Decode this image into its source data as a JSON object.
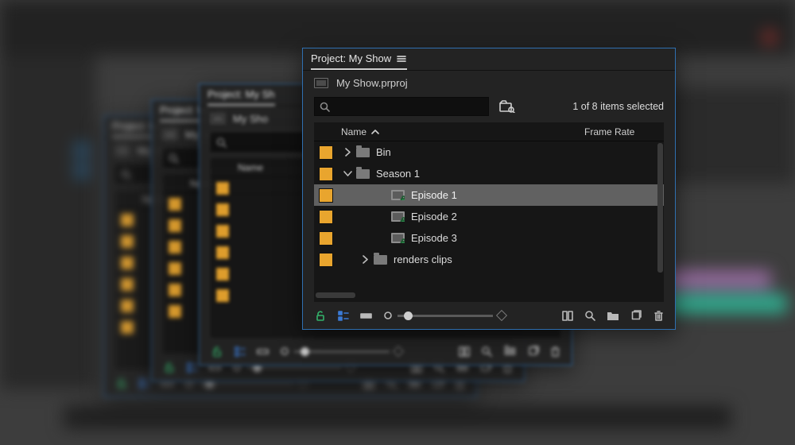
{
  "panel": {
    "tab_title": "Project: My Show",
    "project_file": "My Show.prproj",
    "search_placeholder": "",
    "selection_text": "1 of 8 items selected",
    "columns": {
      "name": "Name",
      "framerate": "Frame Rate"
    },
    "rows": [
      {
        "indent": 0,
        "expander": "right",
        "icon": "folder",
        "label": "Bin",
        "selected": false
      },
      {
        "indent": 0,
        "expander": "down",
        "icon": "folder",
        "label": "Season 1",
        "selected": false
      },
      {
        "indent": 2,
        "expander": "none",
        "icon": "sequence",
        "label": "Episode 1",
        "selected": true
      },
      {
        "indent": 2,
        "expander": "none",
        "icon": "sequence",
        "label": "Episode 2",
        "selected": false
      },
      {
        "indent": 2,
        "expander": "none",
        "icon": "sequence",
        "label": "Episode 3",
        "selected": false
      },
      {
        "indent": 1,
        "expander": "right",
        "icon": "folder",
        "label": "renders clips",
        "selected": false
      }
    ]
  },
  "behind_title": "Project: My Sh",
  "behind_file": "My Sho",
  "icons": {
    "menu": "panel-menu-icon",
    "search": "search-icon",
    "filter": "filter-bin-icon",
    "sort": "sort-asc-icon",
    "lock_open": "lock-open-icon",
    "list_view": "list-view-icon",
    "icon_view": "icon-view-icon",
    "freeform": "freeform-icon",
    "zoom": "zoom-icon",
    "new_bin": "new-bin-icon",
    "new_item": "new-item-icon",
    "trash": "trash-icon",
    "caret_right": "chevron-right-icon",
    "caret_down": "chevron-down-icon"
  }
}
